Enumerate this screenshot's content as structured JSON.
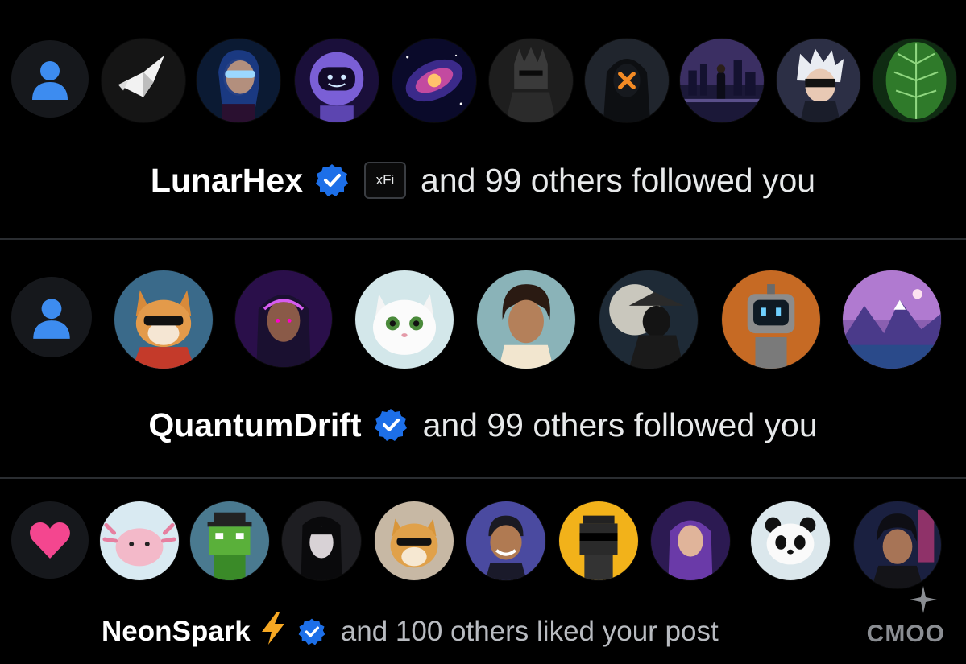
{
  "colors": {
    "background": "#000000",
    "divider": "#2a2d31",
    "verified_blue": "#1d6fe8",
    "person_icon_blue": "#3d8cf0",
    "heart_pink": "#f4468f",
    "bolt_orange": "#f7a823"
  },
  "notifications": [
    {
      "type_icon": "person-icon",
      "avatars": [
        "paper-crane",
        "cyber-woman-visor",
        "astronaut-robot",
        "spiral-galaxy",
        "dark-knight",
        "hooded-figure-x-mask",
        "city-night-skyline",
        "white-hair-anime",
        "green-leaf"
      ],
      "username": "LunarHex",
      "verified_icon": "verified-badge-icon",
      "affiliate": "xFi",
      "action_text": "and 99 others followed you"
    },
    {
      "type_icon": "person-icon",
      "avatars": [
        "corgi-sunglasses",
        "neon-anime-girl",
        "white-kitten",
        "curly-hair-man",
        "samurai-moon",
        "retro-robot",
        "purple-mountains"
      ],
      "username": "QuantumDrift",
      "verified_icon": "verified-badge-icon",
      "action_text": "and 99 others followed you"
    },
    {
      "type_icon": "heart-icon",
      "avatars": [
        "axolotl",
        "pixel-frog-hat",
        "goth-girl",
        "shiba-sunglasses",
        "cartoon-boy",
        "pixel-punk-sunglasses",
        "purple-hair-woman",
        "panda",
        "anime-boy-neon"
      ],
      "username": "NeonSpark",
      "emoji_icon": "lightning-bolt-icon",
      "verified_icon": "verified-badge-icon",
      "action_text": "and 100 others liked your post"
    }
  ],
  "watermark": "CMOO"
}
